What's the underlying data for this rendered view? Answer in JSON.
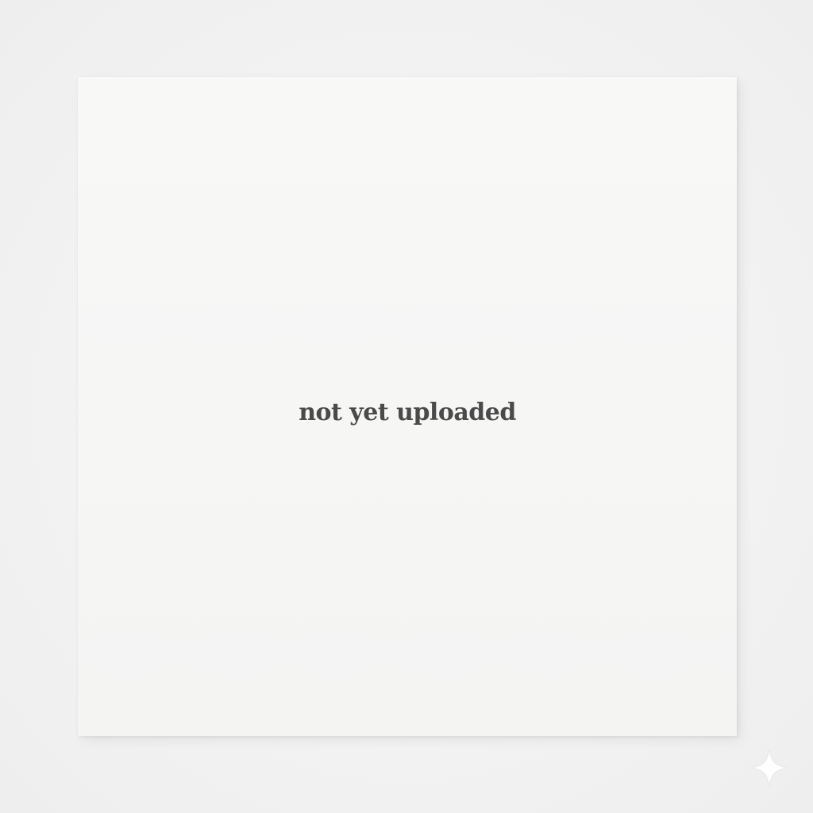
{
  "placeholder": {
    "status_text": "not yet uploaded"
  },
  "colors": {
    "background": "#f2f2f2",
    "card": "#f6f6f5",
    "text": "#4a4a4a",
    "sparkle": "#ffffff"
  },
  "icons": {
    "corner": "sparkle-icon"
  }
}
